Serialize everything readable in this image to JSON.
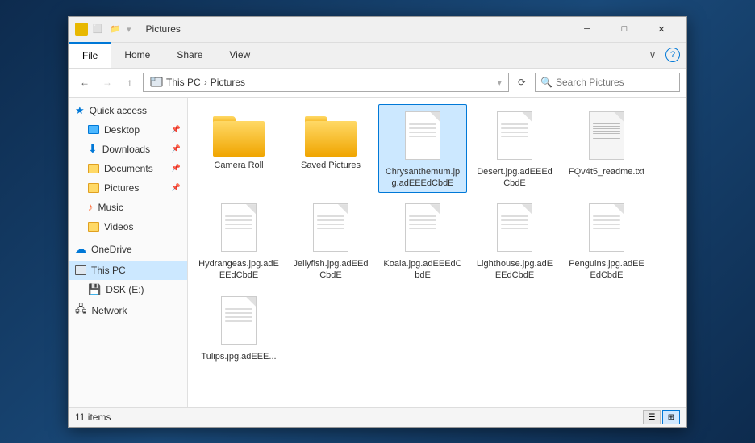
{
  "window": {
    "title": "Pictures",
    "icon": "folder-icon"
  },
  "title_bar": {
    "title": "Pictures",
    "minimize_label": "─",
    "maximize_label": "□",
    "close_label": "✕"
  },
  "ribbon": {
    "tabs": [
      "File",
      "Home",
      "Share",
      "View"
    ],
    "active_tab": "File",
    "chevron_down": "∨",
    "help": "?"
  },
  "address_bar": {
    "back_label": "←",
    "forward_label": "→",
    "up_label": "↑",
    "breadcrumb": [
      "This PC",
      "Pictures"
    ],
    "refresh_label": "⟳",
    "search_placeholder": "Search Pictures"
  },
  "sidebar": {
    "quick_access_label": "Quick access",
    "items": [
      {
        "label": "Desktop",
        "type": "desktop",
        "pinned": true
      },
      {
        "label": "Downloads",
        "type": "downloads",
        "pinned": true
      },
      {
        "label": "Documents",
        "type": "documents",
        "pinned": true
      },
      {
        "label": "Pictures",
        "type": "pictures",
        "pinned": true
      },
      {
        "label": "Music",
        "type": "music"
      },
      {
        "label": "Videos",
        "type": "videos"
      }
    ],
    "onedrive_label": "OneDrive",
    "thispc_label": "This PC",
    "dsk_label": "DSK (E:)",
    "network_label": "Network"
  },
  "files": [
    {
      "name": "Camera Roll",
      "type": "folder"
    },
    {
      "name": "Saved Pictures",
      "type": "folder"
    },
    {
      "name": "Chrysanthemum.jpg.adEEEdCbdE",
      "type": "doc"
    },
    {
      "name": "Desert.jpg.adEEEdCbdE",
      "type": "doc"
    },
    {
      "name": "FQv4t5_readme.txt",
      "type": "doc_lines"
    },
    {
      "name": "Hydrangeas.jpg.adEEEdCbdE",
      "type": "doc"
    },
    {
      "name": "Jellyfish.jpg.adEEdCbdE",
      "type": "doc"
    },
    {
      "name": "Koala.jpg.adEEEdCbdE",
      "type": "doc"
    },
    {
      "name": "Lighthouse.jpg.adEEEdCbdE",
      "type": "doc"
    },
    {
      "name": "Penguins.jpg.adEEEdCbdE",
      "type": "doc"
    },
    {
      "name": "Tulips.jpg.adEEE...",
      "type": "doc"
    }
  ],
  "status_bar": {
    "item_count": "11 items",
    "view_list_label": "☰",
    "view_grid_label": "⊞"
  }
}
